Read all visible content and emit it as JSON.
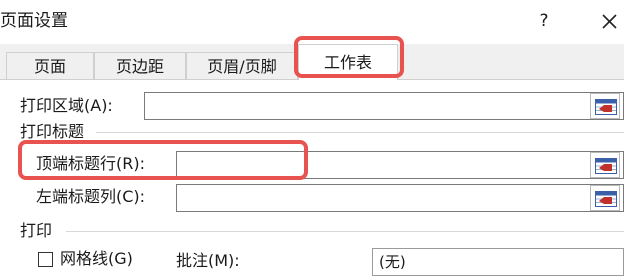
{
  "dialog": {
    "title": "页面设置",
    "help": "?"
  },
  "tabs": [
    {
      "label": "页面"
    },
    {
      "label": "页边距"
    },
    {
      "label": "页眉/页脚"
    },
    {
      "label": "工作表",
      "active": true
    }
  ],
  "sheet": {
    "print_area_label": "打印区域(A):",
    "print_area_value": "",
    "print_titles_heading": "打印标题",
    "rows_repeat_label": "顶端标题行(R):",
    "rows_repeat_value": "",
    "cols_repeat_label": "左端标题列(C):",
    "cols_repeat_value": "",
    "print_heading": "打印",
    "gridlines_label": "网格线(G)",
    "comments_label": "批注(M):",
    "comments_value": "(无)"
  },
  "colors": {
    "highlight": "#e8534f",
    "picker_red": "#c0312b",
    "picker_blue": "#3b5fa8"
  },
  "icons": [
    "help-icon",
    "close-icon",
    "collapse-range-icon"
  ]
}
